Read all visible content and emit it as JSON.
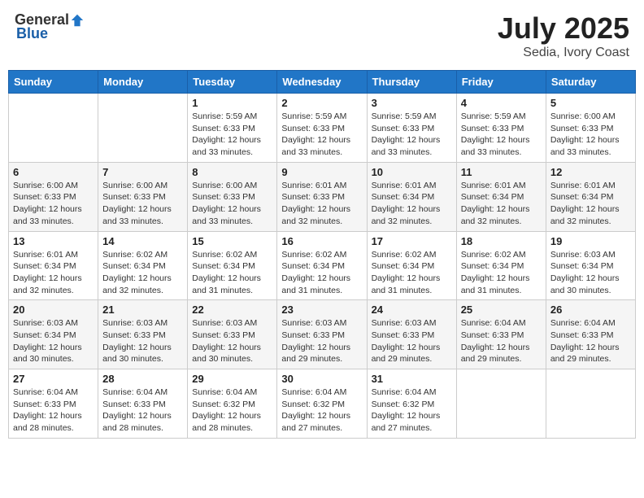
{
  "header": {
    "logo_general": "General",
    "logo_blue": "Blue",
    "main_title": "July 2025",
    "subtitle": "Sedia, Ivory Coast"
  },
  "weekdays": [
    "Sunday",
    "Monday",
    "Tuesday",
    "Wednesday",
    "Thursday",
    "Friday",
    "Saturday"
  ],
  "weeks": [
    [
      {
        "day": "",
        "info": ""
      },
      {
        "day": "",
        "info": ""
      },
      {
        "day": "1",
        "info": "Sunrise: 5:59 AM\nSunset: 6:33 PM\nDaylight: 12 hours and 33 minutes."
      },
      {
        "day": "2",
        "info": "Sunrise: 5:59 AM\nSunset: 6:33 PM\nDaylight: 12 hours and 33 minutes."
      },
      {
        "day": "3",
        "info": "Sunrise: 5:59 AM\nSunset: 6:33 PM\nDaylight: 12 hours and 33 minutes."
      },
      {
        "day": "4",
        "info": "Sunrise: 5:59 AM\nSunset: 6:33 PM\nDaylight: 12 hours and 33 minutes."
      },
      {
        "day": "5",
        "info": "Sunrise: 6:00 AM\nSunset: 6:33 PM\nDaylight: 12 hours and 33 minutes."
      }
    ],
    [
      {
        "day": "6",
        "info": "Sunrise: 6:00 AM\nSunset: 6:33 PM\nDaylight: 12 hours and 33 minutes."
      },
      {
        "day": "7",
        "info": "Sunrise: 6:00 AM\nSunset: 6:33 PM\nDaylight: 12 hours and 33 minutes."
      },
      {
        "day": "8",
        "info": "Sunrise: 6:00 AM\nSunset: 6:33 PM\nDaylight: 12 hours and 33 minutes."
      },
      {
        "day": "9",
        "info": "Sunrise: 6:01 AM\nSunset: 6:33 PM\nDaylight: 12 hours and 32 minutes."
      },
      {
        "day": "10",
        "info": "Sunrise: 6:01 AM\nSunset: 6:34 PM\nDaylight: 12 hours and 32 minutes."
      },
      {
        "day": "11",
        "info": "Sunrise: 6:01 AM\nSunset: 6:34 PM\nDaylight: 12 hours and 32 minutes."
      },
      {
        "day": "12",
        "info": "Sunrise: 6:01 AM\nSunset: 6:34 PM\nDaylight: 12 hours and 32 minutes."
      }
    ],
    [
      {
        "day": "13",
        "info": "Sunrise: 6:01 AM\nSunset: 6:34 PM\nDaylight: 12 hours and 32 minutes."
      },
      {
        "day": "14",
        "info": "Sunrise: 6:02 AM\nSunset: 6:34 PM\nDaylight: 12 hours and 32 minutes."
      },
      {
        "day": "15",
        "info": "Sunrise: 6:02 AM\nSunset: 6:34 PM\nDaylight: 12 hours and 31 minutes."
      },
      {
        "day": "16",
        "info": "Sunrise: 6:02 AM\nSunset: 6:34 PM\nDaylight: 12 hours and 31 minutes."
      },
      {
        "day": "17",
        "info": "Sunrise: 6:02 AM\nSunset: 6:34 PM\nDaylight: 12 hours and 31 minutes."
      },
      {
        "day": "18",
        "info": "Sunrise: 6:02 AM\nSunset: 6:34 PM\nDaylight: 12 hours and 31 minutes."
      },
      {
        "day": "19",
        "info": "Sunrise: 6:03 AM\nSunset: 6:34 PM\nDaylight: 12 hours and 30 minutes."
      }
    ],
    [
      {
        "day": "20",
        "info": "Sunrise: 6:03 AM\nSunset: 6:34 PM\nDaylight: 12 hours and 30 minutes."
      },
      {
        "day": "21",
        "info": "Sunrise: 6:03 AM\nSunset: 6:33 PM\nDaylight: 12 hours and 30 minutes."
      },
      {
        "day": "22",
        "info": "Sunrise: 6:03 AM\nSunset: 6:33 PM\nDaylight: 12 hours and 30 minutes."
      },
      {
        "day": "23",
        "info": "Sunrise: 6:03 AM\nSunset: 6:33 PM\nDaylight: 12 hours and 29 minutes."
      },
      {
        "day": "24",
        "info": "Sunrise: 6:03 AM\nSunset: 6:33 PM\nDaylight: 12 hours and 29 minutes."
      },
      {
        "day": "25",
        "info": "Sunrise: 6:04 AM\nSunset: 6:33 PM\nDaylight: 12 hours and 29 minutes."
      },
      {
        "day": "26",
        "info": "Sunrise: 6:04 AM\nSunset: 6:33 PM\nDaylight: 12 hours and 29 minutes."
      }
    ],
    [
      {
        "day": "27",
        "info": "Sunrise: 6:04 AM\nSunset: 6:33 PM\nDaylight: 12 hours and 28 minutes."
      },
      {
        "day": "28",
        "info": "Sunrise: 6:04 AM\nSunset: 6:33 PM\nDaylight: 12 hours and 28 minutes."
      },
      {
        "day": "29",
        "info": "Sunrise: 6:04 AM\nSunset: 6:32 PM\nDaylight: 12 hours and 28 minutes."
      },
      {
        "day": "30",
        "info": "Sunrise: 6:04 AM\nSunset: 6:32 PM\nDaylight: 12 hours and 27 minutes."
      },
      {
        "day": "31",
        "info": "Sunrise: 6:04 AM\nSunset: 6:32 PM\nDaylight: 12 hours and 27 minutes."
      },
      {
        "day": "",
        "info": ""
      },
      {
        "day": "",
        "info": ""
      }
    ]
  ]
}
